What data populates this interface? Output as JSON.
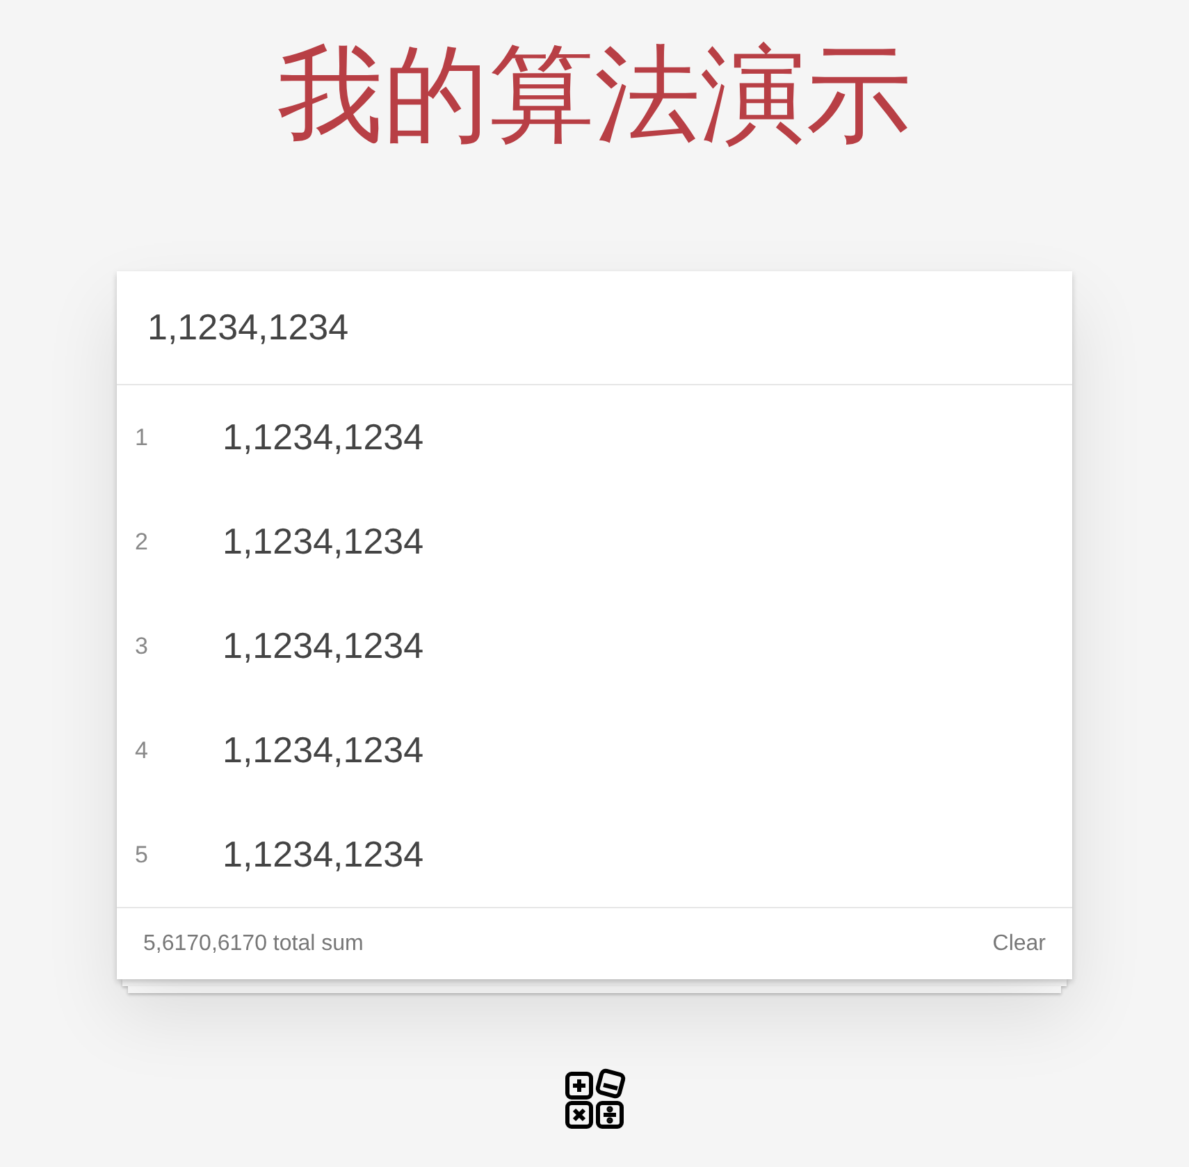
{
  "title": "我的算法演示",
  "input": {
    "value": "1,1234,1234"
  },
  "items": [
    {
      "index": "1",
      "text": "1,1234,1234"
    },
    {
      "index": "2",
      "text": "1,1234,1234"
    },
    {
      "index": "3",
      "text": "1,1234,1234"
    },
    {
      "index": "4",
      "text": "1,1234,1234"
    },
    {
      "index": "5",
      "text": "1,1234,1234"
    }
  ],
  "footer": {
    "summary": "5,6170,6170 total sum",
    "clear": "Clear"
  }
}
